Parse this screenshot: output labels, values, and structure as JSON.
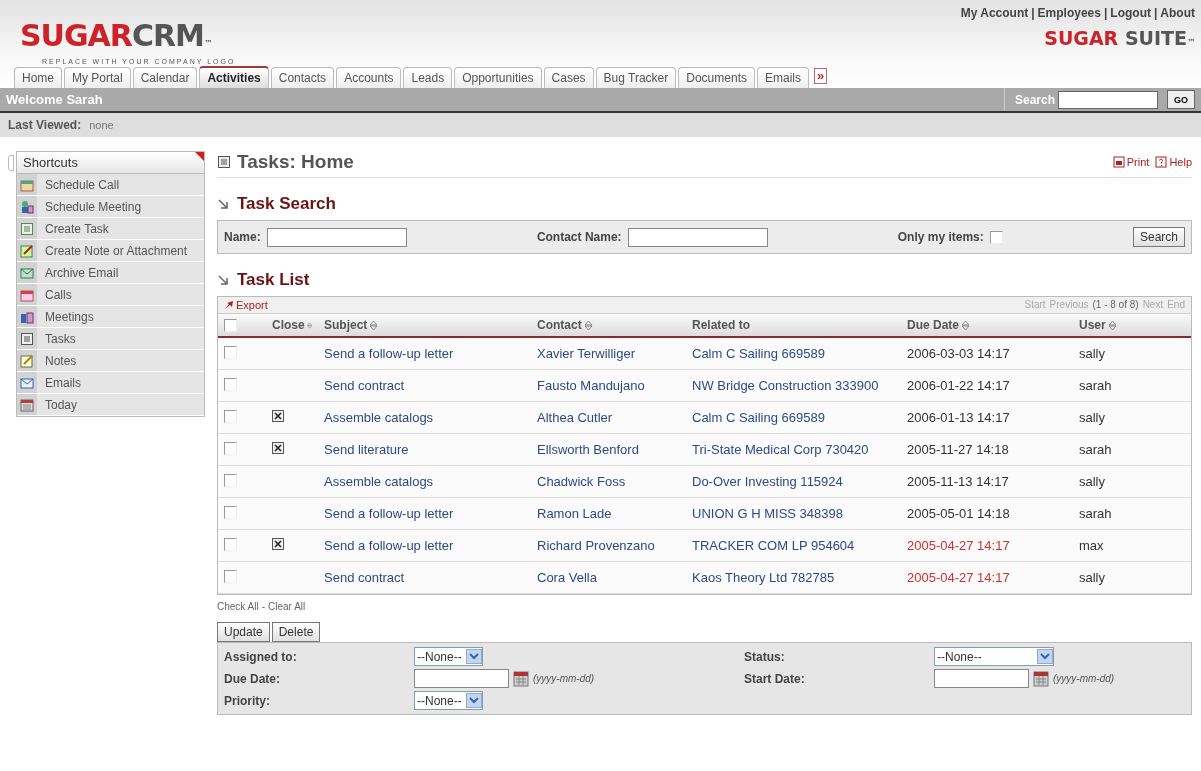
{
  "header": {
    "logo": {
      "red": "SUGAR",
      "grey": "CRM",
      "mark": "™",
      "tagline": "REPLACE WITH YOUR COMPANY LOGO"
    },
    "top_links": [
      "My Account",
      "Employees",
      "Logout",
      "About"
    ],
    "link_separator": "|",
    "suite_logo": {
      "red": "SUGAR",
      "grey": "SUITE",
      "mark": "™"
    }
  },
  "tabs": [
    {
      "label": "Home",
      "selected": false
    },
    {
      "label": "My Portal",
      "selected": false
    },
    {
      "label": "Calendar",
      "selected": false
    },
    {
      "label": "Activities",
      "selected": true
    },
    {
      "label": "Contacts",
      "selected": false
    },
    {
      "label": "Accounts",
      "selected": false
    },
    {
      "label": "Leads",
      "selected": false
    },
    {
      "label": "Opportunities",
      "selected": false
    },
    {
      "label": "Cases",
      "selected": false
    },
    {
      "label": "Bug Tracker",
      "selected": false
    },
    {
      "label": "Documents",
      "selected": false
    },
    {
      "label": "Emails",
      "selected": false
    }
  ],
  "more_tabs": "»",
  "welcome_bar": {
    "greeting": "Welcome Sarah",
    "search_label": "Search",
    "go_button": "GO"
  },
  "last_viewed": {
    "label": "Last Viewed:",
    "value": "none"
  },
  "sidebar": {
    "title": "Shortcuts",
    "items": [
      "Schedule Call",
      "Schedule Meeting",
      "Create Task",
      "Create Note or Attachment",
      "Archive Email",
      "Calls",
      "Meetings",
      "Tasks",
      "Notes",
      "Emails",
      "Today"
    ]
  },
  "page": {
    "title": "Tasks: Home",
    "print": "Print",
    "help": "Help"
  },
  "task_search": {
    "title": "Task Search",
    "name_label": "Name:",
    "contact_label": "Contact Name:",
    "only_mine_label": "Only my items:",
    "only_mine": false,
    "button": "Search"
  },
  "task_list": {
    "title": "Task List",
    "export": "Export",
    "pagination": {
      "start": "Start",
      "previous": "Previous",
      "range": "(1 - 8 of 8)",
      "next": "Next",
      "end": "End"
    },
    "all_selected": false,
    "columns": [
      {
        "label": "Close",
        "sortable": true
      },
      {
        "label": "Subject",
        "sortable": true
      },
      {
        "label": "Contact",
        "sortable": true
      },
      {
        "label": "Related to",
        "sortable": false
      },
      {
        "label": "Due Date",
        "sortable": true
      },
      {
        "label": "User",
        "sortable": true
      }
    ],
    "rows": [
      {
        "selected": false,
        "closed": false,
        "subject": "Send a follow-up letter",
        "contact": "Xavier Terwilliger",
        "related": "Calm C Sailing 669589",
        "due": "2006-03-03 14:17",
        "overdue": false,
        "user": "sally"
      },
      {
        "selected": false,
        "closed": false,
        "subject": "Send contract",
        "contact": "Fausto Mandujano",
        "related": "NW Bridge Construction 333900",
        "due": "2006-01-22 14:17",
        "overdue": false,
        "user": "sarah"
      },
      {
        "selected": false,
        "closed": true,
        "subject": "Assemble catalogs",
        "contact": "Althea Cutler",
        "related": "Calm C Sailing 669589",
        "due": "2006-01-13 14:17",
        "overdue": false,
        "user": "sally"
      },
      {
        "selected": false,
        "closed": true,
        "subject": "Send literature",
        "contact": "Ellsworth Benford",
        "related": "Tri-State Medical Corp 730420",
        "due": "2005-11-27 14:18",
        "overdue": false,
        "user": "sarah"
      },
      {
        "selected": false,
        "closed": false,
        "subject": "Assemble catalogs",
        "contact": "Chadwick Foss",
        "related": "Do-Over Investing 115924",
        "due": "2005-11-13 14:17",
        "overdue": false,
        "user": "sally"
      },
      {
        "selected": false,
        "closed": false,
        "subject": "Send a follow-up letter",
        "contact": "Ramon Lade",
        "related": "UNION G H MISS 348398",
        "due": "2005-05-01 14:18",
        "overdue": false,
        "user": "sarah"
      },
      {
        "selected": false,
        "closed": true,
        "subject": "Send a follow-up letter",
        "contact": "Richard Provenzano",
        "related": "TRACKER COM LP 954604",
        "due": "2005-04-27 14:17",
        "overdue": true,
        "user": "max"
      },
      {
        "selected": false,
        "closed": false,
        "subject": "Send contract",
        "contact": "Cora Vella",
        "related": "Kaos Theory Ltd 782785",
        "due": "2005-04-27 14:17",
        "overdue": true,
        "user": "sally"
      }
    ],
    "check_all": "Check All",
    "check_separator": "-",
    "clear_all": "Clear All"
  },
  "actions": [
    "Update",
    "Delete"
  ],
  "mass_update": [
    {
      "kind": "select",
      "label": "Assigned to:",
      "value": "--None--"
    },
    {
      "kind": "select",
      "label": "Status:",
      "value": "--None--"
    },
    {
      "kind": "date",
      "label": "Due Date:",
      "hint": "(yyyy-mm-dd)"
    },
    {
      "kind": "date",
      "label": "Start Date:",
      "hint": "(yyyy-mm-dd)"
    },
    {
      "kind": "select",
      "label": "Priority:",
      "value": "--None--"
    }
  ]
}
